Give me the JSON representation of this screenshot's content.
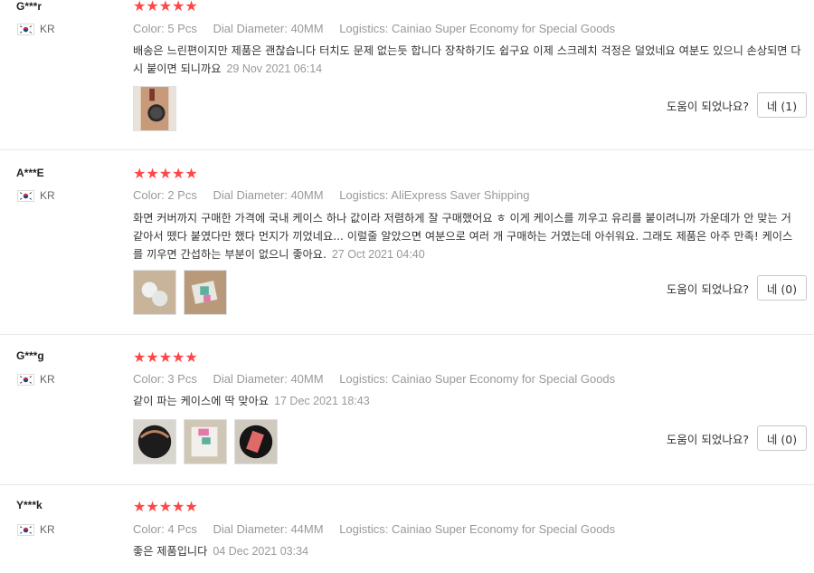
{
  "reviews": [
    {
      "user": "G***r",
      "country": "KR",
      "rating": 5,
      "color_label": "Color:",
      "color": "5 Pcs",
      "dial_label": "Dial Diameter:",
      "dial": "40MM",
      "logistics_label": "Logistics:",
      "logistics": "Cainiao Super Economy for Special Goods",
      "text": "배송은 느린편이지만 제품은 괜찮습니다 터치도 문제 없는듯 합니다 장착하기도 쉽구요 이제 스크레치 걱정은 덜었네요 여분도 있으니 손상되면 다시 붙이면 되니까요",
      "date": "29 Nov 2021 06:14",
      "helpful_question": "도움이 되었나요?",
      "helpful_button": "네 (1)",
      "photos": [
        "watch-on-wrist-photo"
      ]
    },
    {
      "user": "A***E",
      "country": "KR",
      "rating": 5,
      "color_label": "Color:",
      "color": "2 Pcs",
      "dial_label": "Dial Diameter:",
      "dial": "40MM",
      "logistics_label": "Logistics:",
      "logistics": "AliExpress Saver Shipping",
      "text": "화면 커버까지 구매한 가격에 국내 케이스 하나 값이라 저렴하게 잘 구매했어요 ㅎ 이게 케이스를 끼우고 유리를 붙이려니까 가운데가 안 맞는 거 같아서 뗐다 붙였다만 했다 먼지가 끼었네요... 이럴줄 알았으면 여분으로 여러 개 구매하는 거였는데 아쉬워요. 그래도 제품은 아주 만족! 케이스를 끼우면 간섭하는 부분이 없으니 좋아요.",
      "date": "27 Oct 2021 04:40",
      "helpful_question": "도움이 되었나요?",
      "helpful_button": "네 (0)",
      "photos": [
        "clear-cases-photo",
        "screen-protector-package-photo"
      ]
    },
    {
      "user": "G***g",
      "country": "KR",
      "rating": 5,
      "color_label": "Color:",
      "color": "3 Pcs",
      "dial_label": "Dial Diameter:",
      "dial": "40MM",
      "logistics_label": "Logistics:",
      "logistics": "Cainiao Super Economy for Special Goods",
      "text": "같이 파는 케이스에 딱 맞아요",
      "date": "17 Dec 2021 18:43",
      "helpful_question": "도움이 되었나요?",
      "helpful_button": "네 (0)",
      "photos": [
        "watch-face-photo",
        "package-photo",
        "watch-with-protector-photo"
      ]
    },
    {
      "user": "Y***k",
      "country": "KR",
      "rating": 5,
      "color_label": "Color:",
      "color": "4 Pcs",
      "dial_label": "Dial Diameter:",
      "dial": "44MM",
      "logistics_label": "Logistics:",
      "logistics": "Cainiao Super Economy for Special Goods",
      "text": "좋은 제품입니다",
      "date": "04 Dec 2021 03:34",
      "photos": []
    }
  ],
  "colors": {
    "star": "#ff4747",
    "muted": "#999999",
    "border": "#e8e8e8"
  }
}
